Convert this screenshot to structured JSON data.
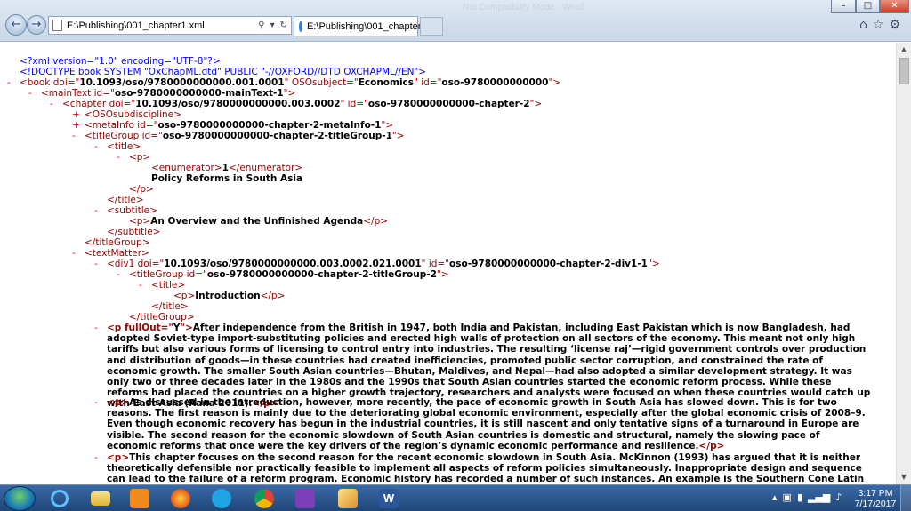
{
  "browser": {
    "address": "E:\\Publishing\\001_chapter1.xml",
    "tab_title": "E:\\Publishing\\001_chapter1...",
    "window_caption": "Not Compatibility Mode - Word"
  },
  "xml_lines": [
    [
      {
        "c": "pi",
        "t": "<?xml version=\"1.0\" encoding=\"UTF-8\"?>"
      }
    ],
    [
      {
        "c": "pi",
        "t": "<!DOCTYPE book SYSTEM \"OxChapML.dtd\" PUBLIC \"-//OXFORD//DTD OXCHAPML//EN\">"
      }
    ],
    [
      {
        "c": "tag",
        "t": "<book "
      },
      {
        "c": "attn",
        "t": "doi=\""
      },
      {
        "c": "attv",
        "t": "10.1093/oso/9780000000000.001.0001"
      },
      {
        "c": "attn",
        "t": "\" OSOsubject=\""
      },
      {
        "c": "attv",
        "t": "Economics"
      },
      {
        "c": "attn",
        "t": "\" id=\""
      },
      {
        "c": "attv",
        "t": "oso-9780000000000"
      },
      {
        "c": "attn",
        "t": "\">"
      }
    ],
    [
      {
        "c": "tag",
        "t": "<mainText "
      },
      {
        "c": "attn",
        "t": "id=\""
      },
      {
        "c": "attv",
        "t": "oso-9780000000000-mainText-1"
      },
      {
        "c": "attn",
        "t": "\">"
      }
    ],
    [
      {
        "c": "tag",
        "t": "<chapter "
      },
      {
        "c": "attn",
        "t": "doi=\""
      },
      {
        "c": "attv",
        "t": "10.1093/oso/9780000000000.003.0002"
      },
      {
        "c": "attn",
        "t": "\" id=\""
      },
      {
        "c": "attv",
        "t": "oso-9780000000000-chapter-2"
      },
      {
        "c": "attn",
        "t": "\">"
      }
    ],
    [
      {
        "c": "tag",
        "t": "<OSOsubdiscipline>"
      }
    ],
    [
      {
        "c": "tag",
        "t": "<metaInfo "
      },
      {
        "c": "attn",
        "t": "id=\""
      },
      {
        "c": "attv",
        "t": "oso-9780000000000-chapter-2-metaInfo-1"
      },
      {
        "c": "attn",
        "t": "\">"
      }
    ],
    [
      {
        "c": "tag",
        "t": "<titleGroup "
      },
      {
        "c": "attn",
        "t": "id=\""
      },
      {
        "c": "attv",
        "t": "oso-9780000000000-chapter-2-titleGroup-1"
      },
      {
        "c": "attn",
        "t": "\">"
      }
    ],
    [
      {
        "c": "tag",
        "t": "<title>"
      }
    ],
    [
      {
        "c": "tag",
        "t": "<p>"
      }
    ],
    [
      {
        "c": "tag",
        "t": "<enumerator>"
      },
      {
        "c": "txt",
        "t": "1"
      },
      {
        "c": "tag",
        "t": "</enumerator>"
      }
    ],
    [
      {
        "c": "txt",
        "t": "Policy Reforms in South Asia"
      }
    ],
    [
      {
        "c": "tag",
        "t": "</p>"
      }
    ],
    [
      {
        "c": "tag",
        "t": "</title>"
      }
    ],
    [
      {
        "c": "tag",
        "t": "<subtitle>"
      }
    ],
    [
      {
        "c": "tag",
        "t": "<p>"
      },
      {
        "c": "txt",
        "t": "An Overview and the Unfinished Agenda"
      },
      {
        "c": "tag",
        "t": "</p>"
      }
    ],
    [
      {
        "c": "tag",
        "t": "</subtitle>"
      }
    ],
    [
      {
        "c": "tag",
        "t": "</titleGroup>"
      }
    ],
    [
      {
        "c": "tag",
        "t": "<textMatter>"
      }
    ],
    [
      {
        "c": "tag",
        "t": "<div1 "
      },
      {
        "c": "attn",
        "t": "doi=\""
      },
      {
        "c": "attv",
        "t": "10.1093/oso/9780000000000.003.0002.021.0001"
      },
      {
        "c": "attn",
        "t": "\" id=\""
      },
      {
        "c": "attv",
        "t": "oso-9780000000000-chapter-2-div1-1"
      },
      {
        "c": "attn",
        "t": "\">"
      }
    ],
    [
      {
        "c": "tag",
        "t": "<titleGroup "
      },
      {
        "c": "attn",
        "t": "id=\""
      },
      {
        "c": "attv",
        "t": "oso-9780000000000-chapter-2-titleGroup-2"
      },
      {
        "c": "attn",
        "t": "\">"
      }
    ],
    [
      {
        "c": "tag",
        "t": "<title>"
      }
    ],
    [
      {
        "c": "tag",
        "t": "<p>"
      },
      {
        "c": "txt",
        "t": "Introduction"
      },
      {
        "c": "tag",
        "t": "</p>"
      }
    ],
    [
      {
        "c": "tag",
        "t": "</title>"
      }
    ],
    [
      {
        "c": "tag",
        "t": "</titleGroup>"
      }
    ]
  ],
  "paragraphs": [
    {
      "open": "<p fullOut=\"",
      "attr_value": "Y",
      "open_end": "\">",
      "text": "After independence from the British in 1947, both India and Pakistan, including East Pakistan which is now Bangladesh, had adopted Soviet-type import-substituting policies and erected high walls of protection on all sectors of the economy. This meant not only high tariffs but also various forms of licensing to control entry into industries. The resulting ‘license raj’—rigid government controls over production and distribution of goods—in these countries had created inefficiencies, promoted public sector corruption, and constrained the rate of economic growth. The smaller South Asian countries—Bhutan, Maldives, and Nepal—had also adopted a similar development strategy. It was only two or three decades later in the 1980s and the 1990s that South Asian countries started the economic reform process. While these reforms had placed the countries on a higher growth trajectory, researchers and analysts were focused on when these countries would catch up with East Asia (Rana 2011).",
      "close": "</p>"
    },
    {
      "open": "<p>",
      "text": "As discussed in the introduction, however, more recently, the pace of economic growth in South Asia has slowed down. This is for two reasons. The first reason is mainly due to the deteriorating global economic environment, especially after the global economic crisis of 2008–9. Even though economic recovery has begun in the industrial countries, it is still nascent and only tentative signs of a turnaround in Europe are visible. The second reason for the economic slowdown of South Asian countries is domestic and structural, namely the slowing pace of economic reforms that once were the key drivers of the region’s dynamic economic performance and resilience.",
      "close": "</p>"
    },
    {
      "open": "<p>",
      "text": "This chapter focuses on the second reason for the recent economic slowdown in South Asia. McKinnon (1993) has argued that it is neither theoretically defensible nor practically feasible to implement all aspects of reform policies simultaneously. Inappropriate design and sequence can lead to the failure of a reform program. Economic history has recorded a number of such instances. An example is the Southern Cone Latin American",
      "close": ""
    }
  ],
  "toggles": {
    "minus": "-",
    "plus": "+"
  },
  "taskbar": {
    "word_label": "W",
    "clock_time": "3:17 PM",
    "clock_date": "7/17/2017"
  }
}
